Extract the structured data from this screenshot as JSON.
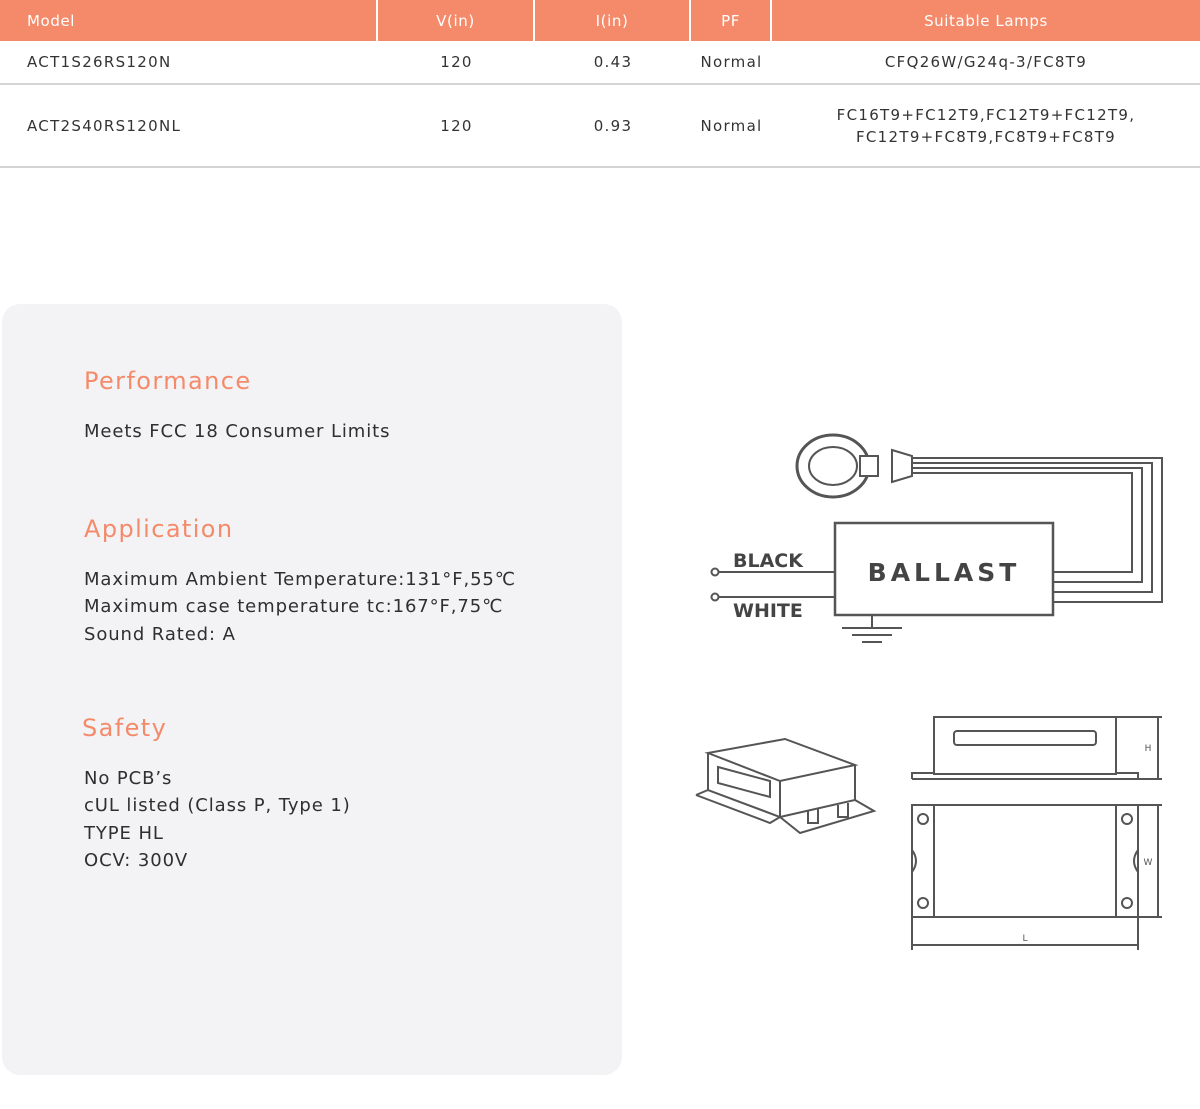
{
  "spec_table": {
    "headers": [
      "Model",
      "V(in)",
      "I(in)",
      "PF",
      "Suitable Lamps"
    ],
    "rows": [
      {
        "model": "ACT1S26RS120N",
        "v_in": "120",
        "i_in": "0.43",
        "pf": "Normal",
        "lamps": "CFQ26W/G24q-3/FC8T9"
      },
      {
        "model": "ACT2S40RS120NL",
        "v_in": "120",
        "i_in": "0.93",
        "pf": "Normal",
        "lamps": "FC16T9+FC12T9,FC12T9+FC12T9, FC12T9+FC8T9,FC8T9+FC8T9"
      }
    ]
  },
  "features": {
    "performance": {
      "title": "Performance",
      "lines": [
        "Meets FCC 18 Consumer Limits"
      ]
    },
    "application": {
      "title": "Application",
      "lines": [
        "Maximum Ambient Temperature:131°F,55℃",
        "Maximum case temperature tc:167°F,75℃",
        "Sound Rated: A"
      ]
    },
    "safety": {
      "title": "Safety",
      "lines": [
        "No PCB’s",
        "cUL listed (Class P, Type 1)",
        "TYPE HL",
        "OCV: 300V"
      ]
    }
  },
  "wiring_diagram": {
    "ballast_label": "BALLAST",
    "black_label": "BLACK",
    "white_label": "WHITE"
  },
  "dimension_diagram": {
    "h_label": "H",
    "w_label": "W",
    "l_label": "L"
  },
  "colors": {
    "accent": "#f58a6b",
    "card_background": "#f3f3f5",
    "row_divider": "#d4d4d4"
  }
}
